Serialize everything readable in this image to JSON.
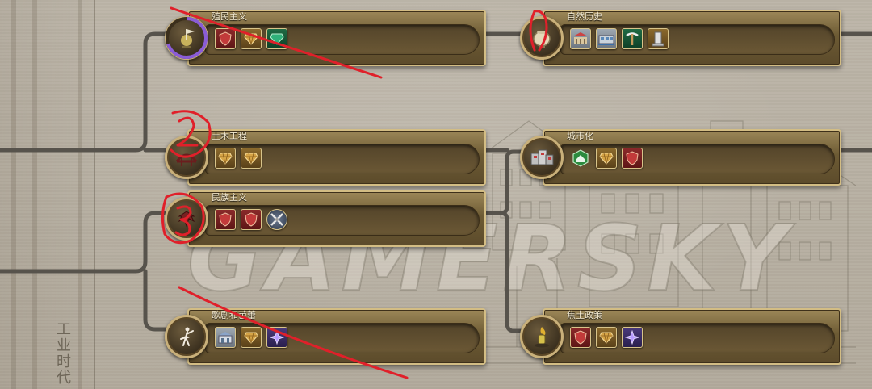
{
  "era": {
    "label": "工业时代"
  },
  "watermark": "GAMERSKY",
  "colors": {
    "parchment": "#b7b0a3",
    "connector": "#57534c",
    "node_border": "#d3bd84",
    "annotation": "#e0202a",
    "progress": "#8a5cd6"
  },
  "nodes": [
    {
      "id": "colonialism",
      "title": "殖民主义",
      "icon": "globe-flag-icon",
      "researched_progress": 0.7,
      "unlocks": [
        {
          "name": "red-shield-icon",
          "color": "red"
        },
        {
          "name": "gem-icon",
          "color": "gold"
        },
        {
          "name": "green-gem-icon",
          "color": "green"
        }
      ]
    },
    {
      "id": "natural-history",
      "title": "自然历史",
      "icon": "urn-icon",
      "unlocks": [
        {
          "name": "museum-building-icon",
          "color": "photo"
        },
        {
          "name": "harbor-building-icon",
          "color": "photo"
        },
        {
          "name": "pickaxe-icon",
          "color": "green"
        },
        {
          "name": "monument-icon",
          "color": "gold"
        }
      ]
    },
    {
      "id": "civil-engineering",
      "title": "土木工程",
      "icon": "bridge-icon",
      "unlocks": [
        {
          "name": "gem-icon",
          "color": "gold"
        },
        {
          "name": "gem-icon",
          "color": "gold"
        }
      ]
    },
    {
      "id": "urbanization",
      "title": "城市化",
      "icon": "city-block-icon",
      "unlocks": [
        {
          "name": "housing-hex-icon",
          "color": "green"
        },
        {
          "name": "gem-icon",
          "color": "gold"
        },
        {
          "name": "red-shield-icon",
          "color": "red"
        }
      ]
    },
    {
      "id": "nationalism",
      "title": "民族主义",
      "icon": "eagle-banner-icon",
      "unlocks": [
        {
          "name": "red-shield-icon",
          "color": "red"
        },
        {
          "name": "red-shield-icon",
          "color": "red"
        },
        {
          "name": "crossed-swords-icon",
          "color": "round"
        }
      ]
    },
    {
      "id": "opera-ballet",
      "title": "歌剧和芭蕾",
      "icon": "ballerina-icon",
      "unlocks": [
        {
          "name": "opera-house-icon",
          "color": "photo"
        },
        {
          "name": "gem-icon",
          "color": "gold"
        },
        {
          "name": "purple-star-icon",
          "color": "purple"
        }
      ]
    },
    {
      "id": "scorched-earth",
      "title": "焦土政策",
      "icon": "torch-icon",
      "unlocks": [
        {
          "name": "red-shield-icon",
          "color": "red"
        },
        {
          "name": "gem-icon",
          "color": "gold"
        },
        {
          "name": "purple-star-icon",
          "color": "purple"
        }
      ]
    }
  ]
}
